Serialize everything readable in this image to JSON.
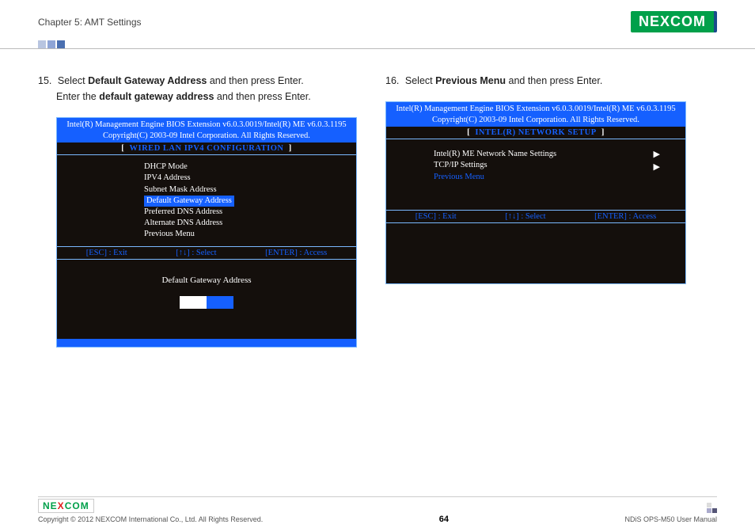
{
  "header": {
    "chapter": "Chapter 5: AMT Settings",
    "logo": "NEXCOM"
  },
  "left": {
    "step_num": "15.",
    "line1_pre": "Select ",
    "line1_bold": "Default Gateway Address",
    "line1_post": " and then press Enter.",
    "line2_pre": "Enter the ",
    "line2_bold": "default gateway address",
    "line2_post": " and then press Enter.",
    "bios_header_l1": "Intel(R) Management Engine BIOS Extension v6.0.3.0019/Intel(R) ME v6.0.3.1195",
    "bios_header_l2": "Copyright(C) 2003-09 Intel Corporation. All Rights Reserved.",
    "section_title": "WIRED LAN IPV4 CONFIGURATION",
    "menu": [
      "DHCP Mode",
      "IPV4 Address",
      "Subnet Mask Address",
      "Default Gateway Address",
      "Preferred DNS Address",
      "Alternate DNS Address",
      "Previous Menu"
    ],
    "keys": {
      "esc": "[ESC] : Exit",
      "sel": "[↑↓] : Select",
      "enter": "[ENTER] : Access"
    },
    "gateway_label": "Default Gateway Address"
  },
  "right": {
    "step_num": "16.",
    "line1_pre": "Select ",
    "line1_bold": "Previous Menu",
    "line1_post": " and then press Enter.",
    "bios_header_l1": "Intel(R) Management Engine BIOS Extension v6.0.3.0019/Intel(R) ME v6.0.3.1195",
    "bios_header_l2": "Copyright(C) 2003-09 Intel Corporation. All Rights Reserved.",
    "section_title": "INTEL(R) NETWORK SETUP",
    "menu": [
      "Intel(R) ME Network Name Settings",
      "TCP/IP Settings",
      "Previous Menu"
    ],
    "keys": {
      "esc": "[ESC] : Exit",
      "sel": "[↑↓] : Select",
      "enter": "[ENTER] : Access"
    }
  },
  "footer": {
    "logo": "NEXCOM",
    "copyright": "Copyright © 2012 NEXCOM International Co., Ltd. All Rights Reserved.",
    "page": "64",
    "manual": "NDiS OPS-M50 User Manual"
  }
}
